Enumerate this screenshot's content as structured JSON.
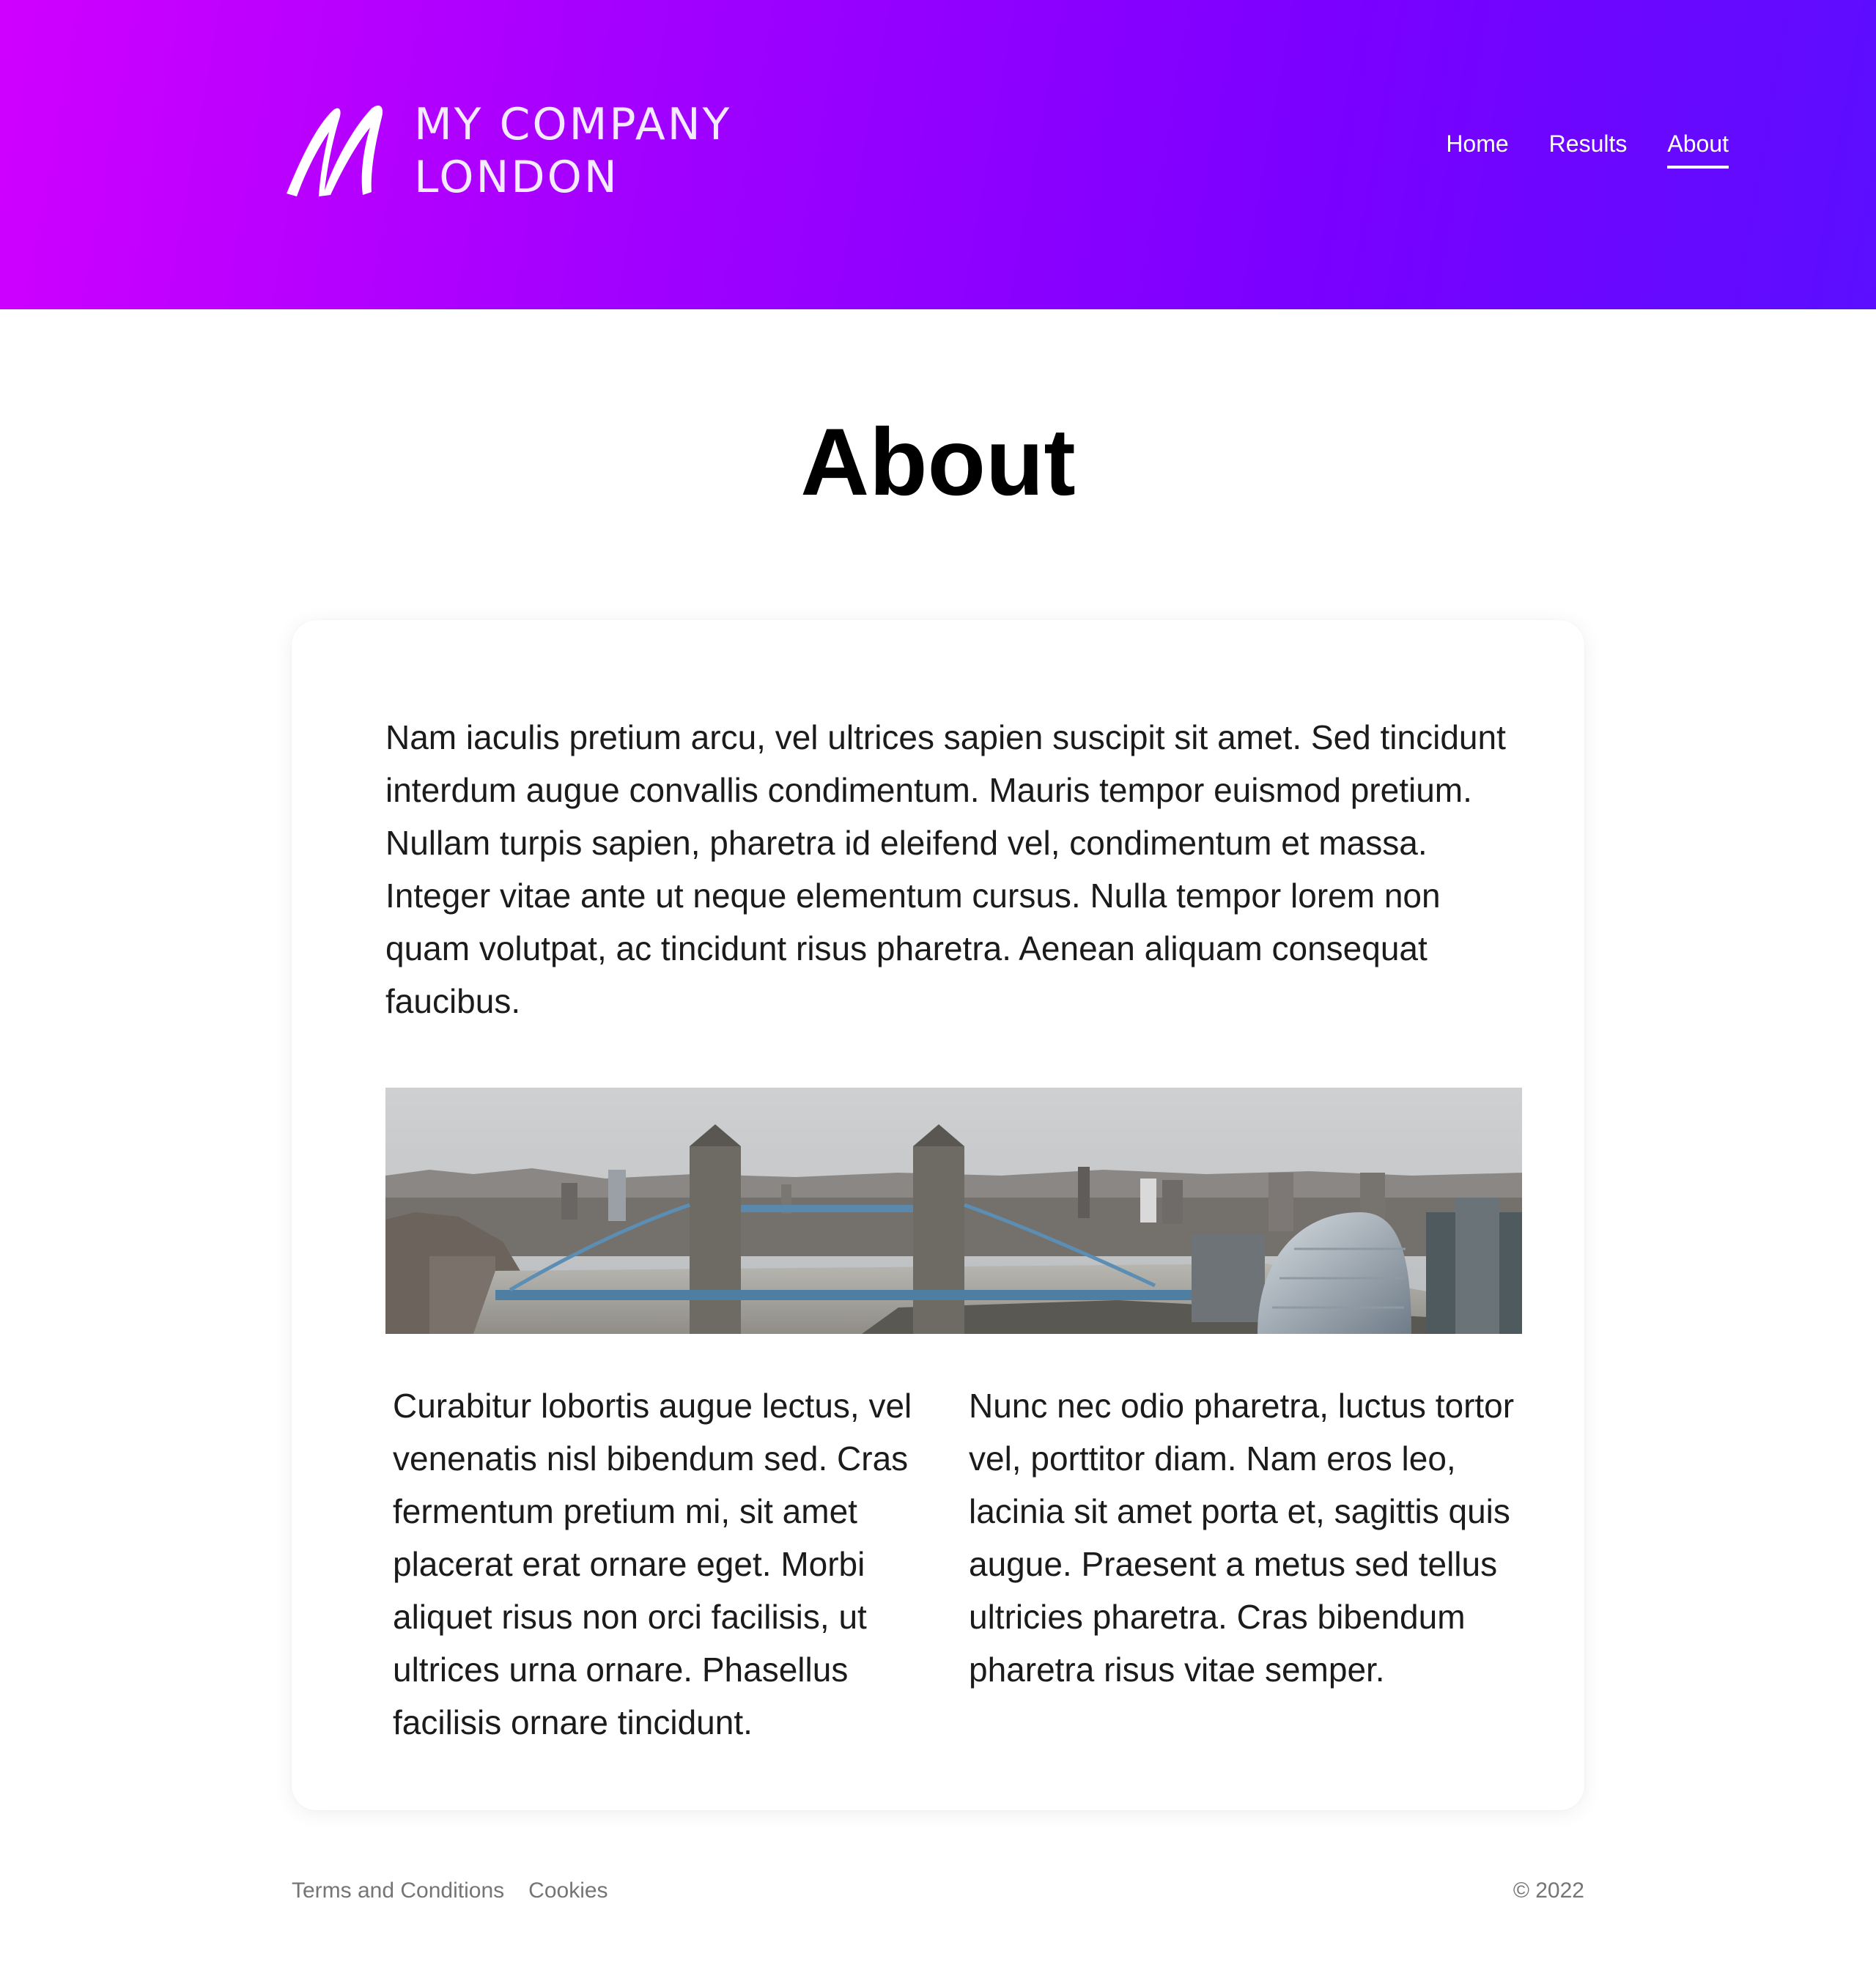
{
  "header": {
    "logo": {
      "line1": "MY COMPANY",
      "line2": "LONDON",
      "mark": "M"
    },
    "nav": [
      {
        "label": "Home",
        "active": false
      },
      {
        "label": "Results",
        "active": false
      },
      {
        "label": "About",
        "active": true
      }
    ],
    "gradient": [
      "#d000ff",
      "#5b0eff"
    ]
  },
  "main": {
    "title": "About",
    "intro": "Nam iaculis pretium arcu, vel ultrices sapien suscipit sit amet. Sed tincidunt interdum augue convallis condimentum. Mauris tempor euismod pretium. Nullam turpis sapien, pharetra id eleifend vel, condimentum et massa. Integer vitae ante ut neque elementum cursus. Nulla tempor lorem non quam volutpat, ac tincidunt risus pharetra. Aenean aliquam consequat faucibus.",
    "columns": [
      "Curabitur lobortis augue lectus, vel venenatis nisl bibendum sed. Cras fermentum pretium mi, sit amet placerat erat ornare eget. Morbi aliquet risus non orci facilisis, ut ultrices urna ornare. Phasellus facilisis ornare tincidunt.",
      "Nunc nec odio pharetra, luctus tortor vel, porttitor diam. Nam eros leo, lacinia sit amet porta et, sagittis quis augue. Praesent a metus sed tellus ultricies pharetra. Cras bibendum pharetra risus vitae semper."
    ]
  },
  "footer": {
    "links": [
      "Terms and Conditions",
      "Cookies"
    ],
    "copyright": "© 2022"
  }
}
